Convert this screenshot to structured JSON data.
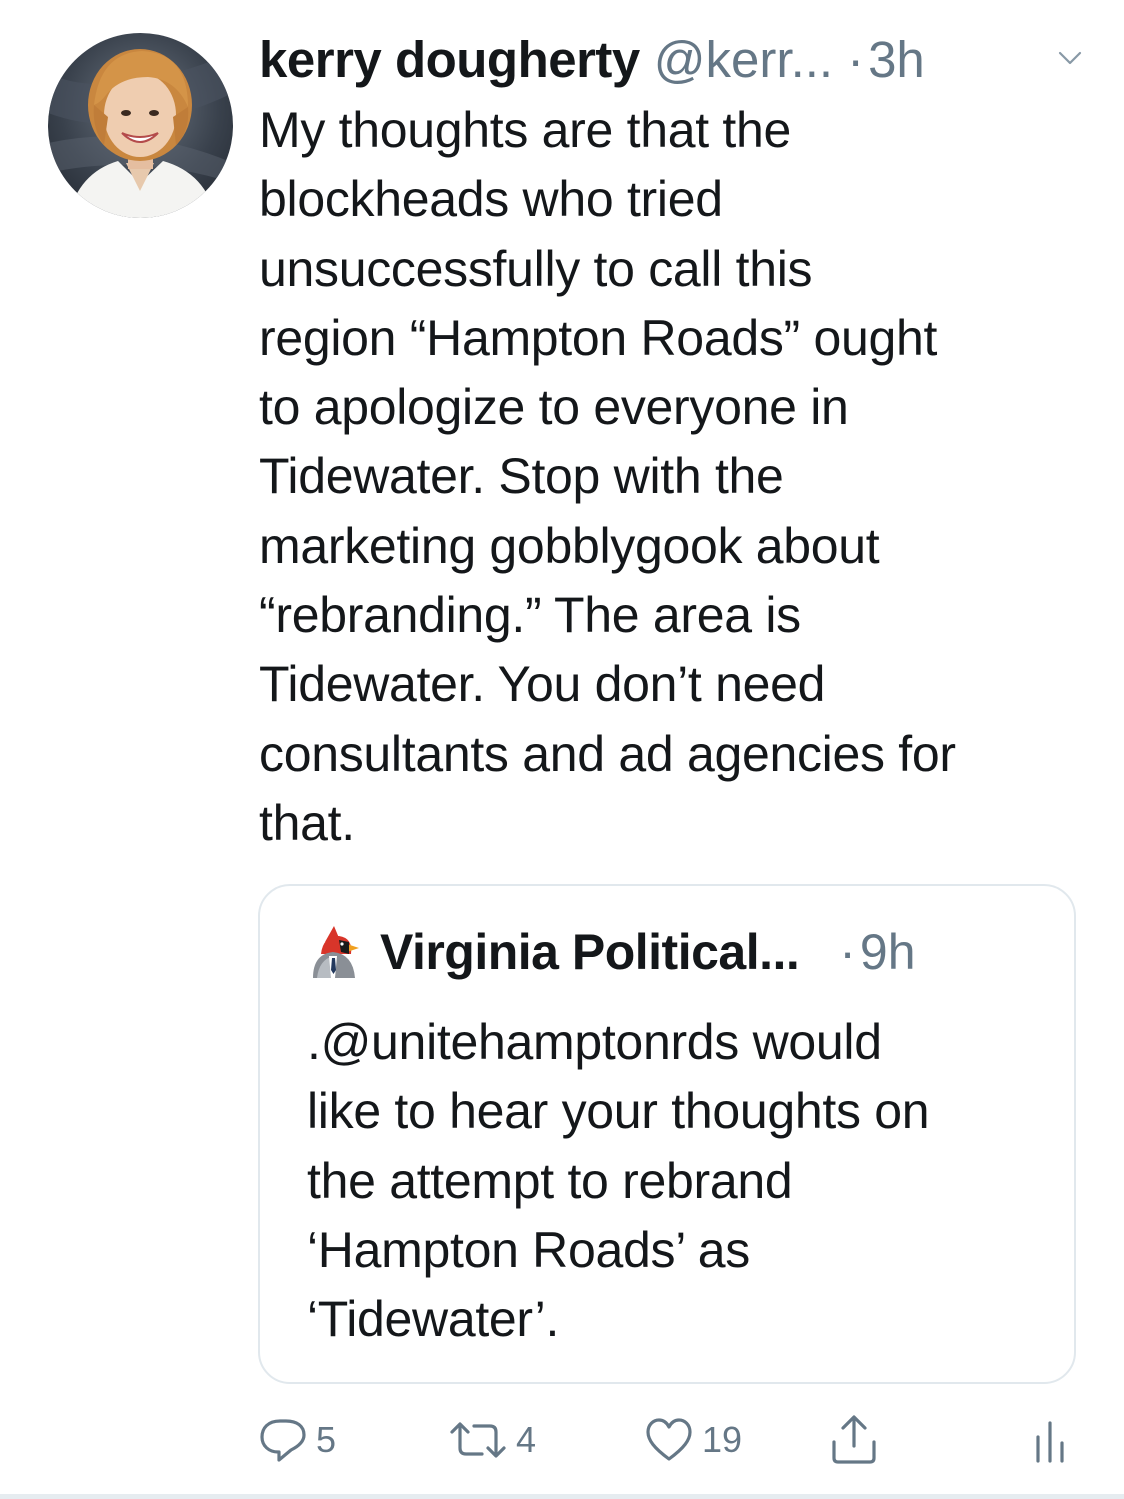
{
  "tweet": {
    "author_name": "kerry dougherty",
    "author_handle": "@kerr...",
    "separator": "·",
    "time": "3h",
    "text": "My thoughts are that the\nblockheads who tried\nunsuccessfully to call this\nregion “Hampton Roads” ought\nto apologize to everyone in\nTidewater. Stop with the\nmarketing gobblygook about\n“rebranding.” The area is\nTidewater. You don’t need\nconsultants and ad agencies for\nthat.",
    "more_icon": "chevron-down-icon",
    "avatar_icon": "profile-photo"
  },
  "quoted_tweet": {
    "author_name": "Virginia Political...",
    "separator": "·",
    "time": "9h",
    "text": ".@unitehamptonrds would\nlike to hear your thoughts on\nthe attempt to rebrand\n‘Hampton Roads’ as\n‘Tidewater’.",
    "avatar_icon": "cardinal-bird-icon"
  },
  "actions": {
    "reply_count": "5",
    "retweet_count": "4",
    "like_count": "19",
    "reply_icon": "speech-bubble-icon",
    "retweet_icon": "retweet-arrows-icon",
    "like_icon": "heart-icon",
    "share_icon": "share-icon",
    "stats_icon": "bar-chart-icon"
  },
  "colors": {
    "text": "#14171a",
    "secondary": "#657786",
    "border": "#e1e8ed",
    "cardinal_red": "#d8352a"
  }
}
